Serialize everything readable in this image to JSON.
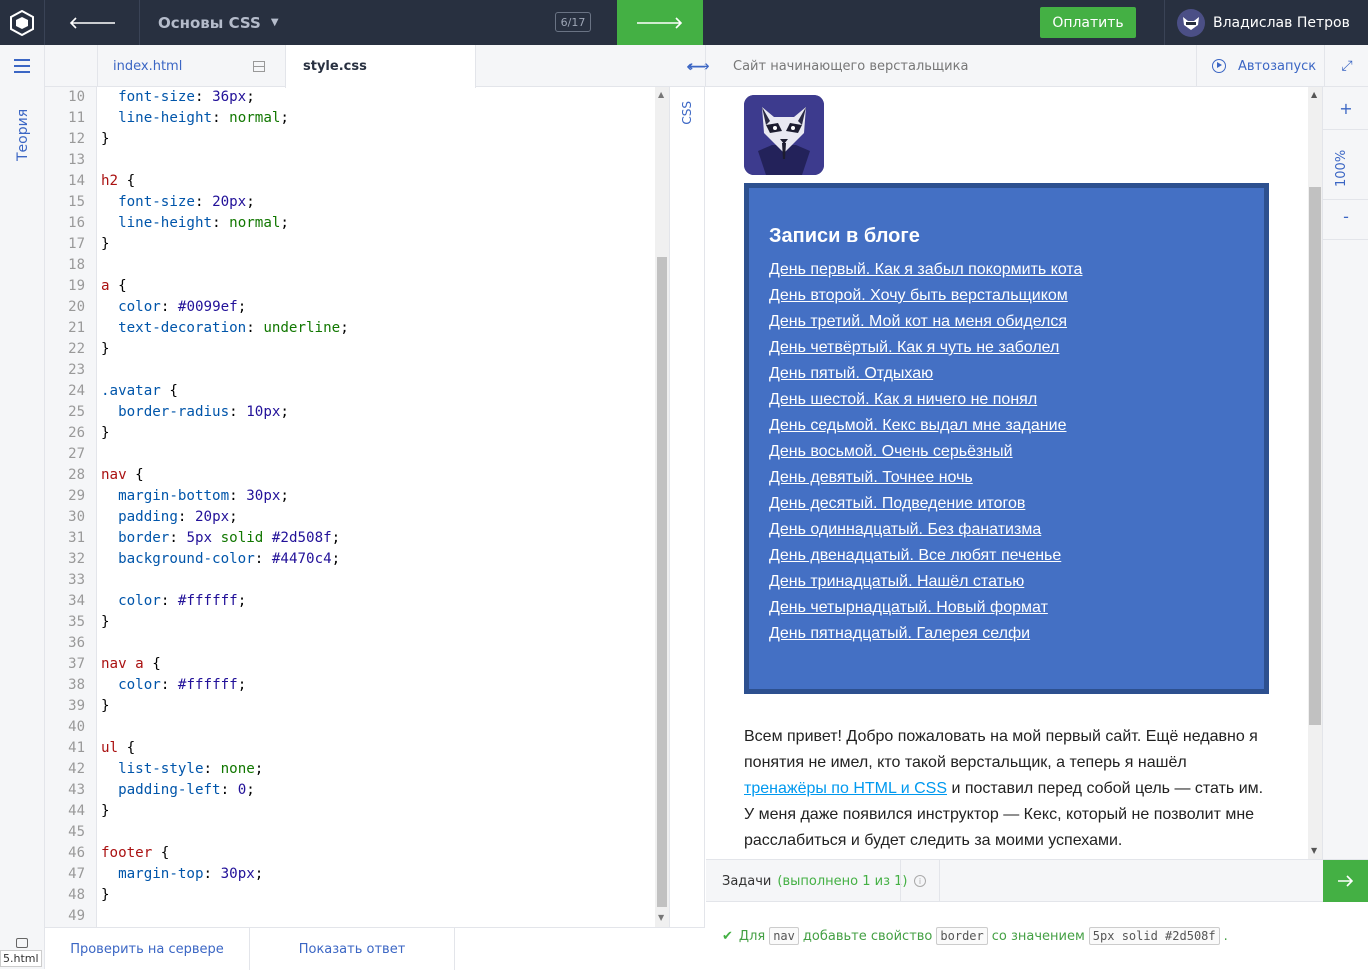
{
  "topbar": {
    "course_title": "Основы CSS",
    "progress": "6/17",
    "pay_label": "Оплатить",
    "user_name": "Владислав Петров"
  },
  "sidebar": {
    "theory_label": "Теория",
    "file_label": "5.html"
  },
  "editor": {
    "tabs": [
      {
        "label": "index.html"
      },
      {
        "label": "style.css",
        "active": true
      }
    ],
    "side_label": "CSS",
    "check_button": "Проверить на сервере",
    "answer_button": "Показать ответ",
    "lines": [
      {
        "n": "10",
        "text": "  font-size: 36px;"
      },
      {
        "n": "11",
        "text": "  line-height: normal;"
      },
      {
        "n": "12",
        "text": "}"
      },
      {
        "n": "13",
        "text": ""
      },
      {
        "n": "14",
        "text": "h2 {"
      },
      {
        "n": "15",
        "text": "  font-size: 20px;"
      },
      {
        "n": "16",
        "text": "  line-height: normal;"
      },
      {
        "n": "17",
        "text": "}"
      },
      {
        "n": "18",
        "text": ""
      },
      {
        "n": "19",
        "text": "a {"
      },
      {
        "n": "20",
        "text": "  color: #0099ef;"
      },
      {
        "n": "21",
        "text": "  text-decoration: underline;"
      },
      {
        "n": "22",
        "text": "}"
      },
      {
        "n": "23",
        "text": ""
      },
      {
        "n": "24",
        "text": ".avatar {"
      },
      {
        "n": "25",
        "text": "  border-radius: 10px;"
      },
      {
        "n": "26",
        "text": "}"
      },
      {
        "n": "27",
        "text": ""
      },
      {
        "n": "28",
        "text": "nav {"
      },
      {
        "n": "29",
        "text": "  margin-bottom: 30px;"
      },
      {
        "n": "30",
        "text": "  padding: 20px;"
      },
      {
        "n": "31",
        "text": "  border: 5px solid #2d508f;"
      },
      {
        "n": "32",
        "text": "  background-color: #4470c4;"
      },
      {
        "n": "33",
        "text": ""
      },
      {
        "n": "34",
        "text": "  color: #ffffff;"
      },
      {
        "n": "35",
        "text": "}"
      },
      {
        "n": "36",
        "text": ""
      },
      {
        "n": "37",
        "text": "nav a {"
      },
      {
        "n": "38",
        "text": "  color: #ffffff;"
      },
      {
        "n": "39",
        "text": "}"
      },
      {
        "n": "40",
        "text": ""
      },
      {
        "n": "41",
        "text": "ul {"
      },
      {
        "n": "42",
        "text": "  list-style: none;"
      },
      {
        "n": "43",
        "text": "  padding-left: 0;"
      },
      {
        "n": "44",
        "text": "}"
      },
      {
        "n": "45",
        "text": ""
      },
      {
        "n": "46",
        "text": "footer {"
      },
      {
        "n": "47",
        "text": "  margin-top: 30px;"
      },
      {
        "n": "48",
        "text": "}"
      },
      {
        "n": "49",
        "text": ""
      }
    ]
  },
  "preview": {
    "site_title": "Сайт начинающего верстальщика",
    "autorun_label": "Автозапуск",
    "zoom_level": "100%",
    "zoom_in": "+",
    "zoom_out": "-",
    "nav_heading": "Записи в блоге",
    "nav_links": [
      "День первый. Как я забыл покормить кота",
      "День второй. Хочу быть верстальщиком",
      "День третий. Мой кот на меня обиделся",
      "День четвёртый. Как я чуть не заболел",
      "День пятый. Отдыхаю",
      "День шестой. Как я ничего не понял",
      "День седьмой. Кекс выдал мне задание",
      "День восьмой. Очень серьёзный",
      "День девятый. Точнее ночь",
      "День десятый. Подведение итогов",
      "День одиннадцатый. Без фанатизма",
      "День двенадцатый. Все любят печенье",
      "День тринадцатый. Нашёл статью",
      "День четырнадцатый. Новый формат",
      "День пятнадцатый. Галерея селфи"
    ],
    "intro_part1": "Всем привет! Добро пожаловать на мой первый сайт. Ещё недавно я понятия не имел, кто такой верстальщик, а теперь я нашёл ",
    "intro_link": "тренажёры по HTML и CSS",
    "intro_part2": " и поставил перед собой цель — стать им. У меня даже появился инструктор — Кекс, который не позволит мне расслабиться и будет следить за моими успехами."
  },
  "tasks": {
    "label": "Задачи",
    "status": "(выполнено 1 из 1)",
    "task_prefix": "Для",
    "task_code1": "nav",
    "task_middle": "добавьте свойство",
    "task_code2": "border",
    "task_middle2": "со значением",
    "task_code3": "5px solid #2d508f",
    "task_suffix": "."
  },
  "colors": {
    "topbar_bg": "#283040",
    "accent_green": "#44b044",
    "accent_blue": "#3b66c4",
    "nav_bg": "#4470c4",
    "nav_border": "#2d508f",
    "link": "#0099ef"
  }
}
